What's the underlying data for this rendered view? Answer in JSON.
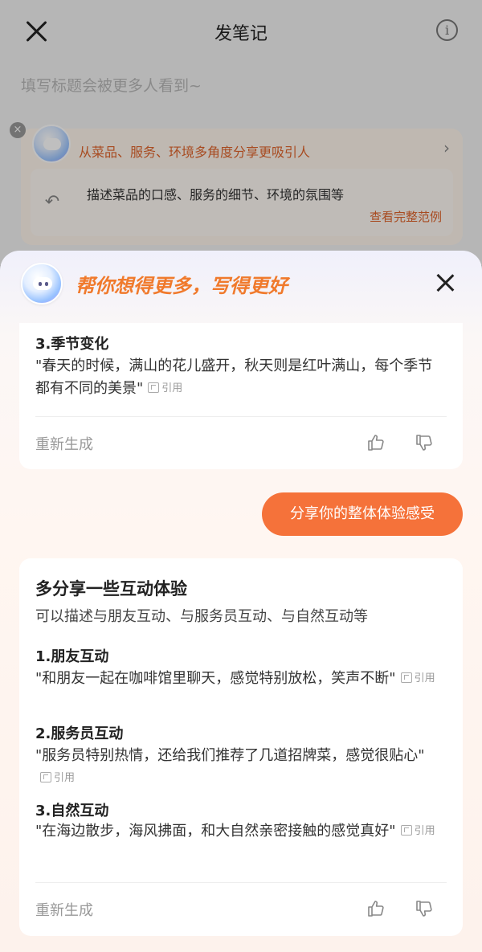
{
  "header": {
    "title": "发笔记"
  },
  "title_placeholder": "填写标题会被更多人看到~",
  "tip": {
    "headline": "从菜品、服务、环境多角度分享更吸引人",
    "description": "描述菜品的口感、服务的细节、环境的氛围等",
    "link": "查看完整范例"
  },
  "sheet": {
    "title": "帮你想得更多，写得更好",
    "card1": {
      "item_title": "3.季节变化",
      "item_body": "\"春天的时候，满山的花儿盛开，秋天则是红叶满山，每个季节都有不同的美景\"",
      "quote_label": "引用",
      "regenerate": "重新生成"
    },
    "prompt_chip": "分享你的整体体验感受",
    "card2": {
      "heading": "多分享一些互动体验",
      "subheading": "可以描述与朋友互动、与服务员互动、与自然互动等",
      "items": [
        {
          "title": "1.朋友互动",
          "body": "\"和朋友一起在咖啡馆里聊天，感觉特别放松，笑声不断\"",
          "quote": "引用"
        },
        {
          "title": "2.服务员互动",
          "body": "\"服务员特别热情，还给我们推荐了几道招牌菜，感觉很贴心\"",
          "quote": "引用"
        },
        {
          "title": "3.自然互动",
          "body": "\"在海边散步，海风拂面，和大自然亲密接触的感觉真好\"",
          "quote": "引用"
        }
      ],
      "regenerate": "重新生成"
    }
  },
  "colors": {
    "accent": "#f5723a",
    "tip_text": "#e0652c"
  }
}
